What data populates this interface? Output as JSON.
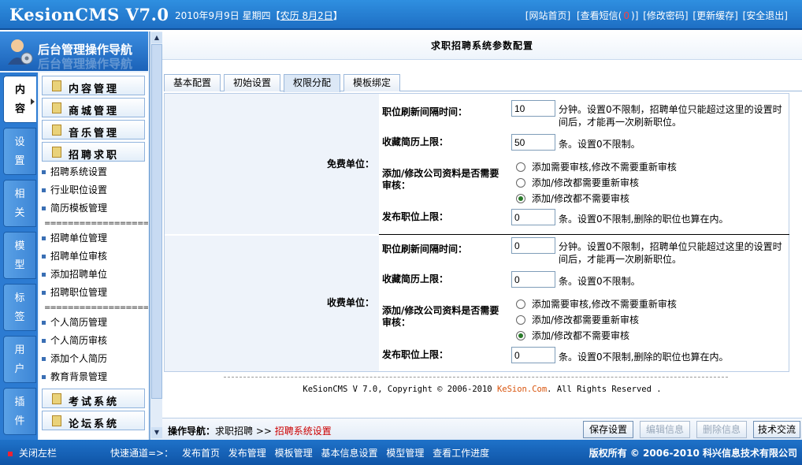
{
  "header": {
    "logo": "KesionCMS V7.0",
    "date_prefix": "2010年9月9日 星期四【",
    "lunar": "农历 8月2日",
    "date_suffix": "】",
    "links": [
      "[网站首页]",
      "[查看短信(",
      "0",
      ")]",
      "[修改密码]",
      "[更新缓存]",
      "[安全退出]"
    ]
  },
  "sidebar": {
    "title": "后台管理操作导航",
    "vertical_tabs": [
      "内\n容",
      "设\n置",
      "相\n关",
      "模\n型",
      "标\n签",
      "用\n户",
      "插\n件"
    ],
    "menu_heads": [
      "内容管理",
      "商城管理",
      "音乐管理",
      "招聘求职"
    ],
    "recruit_items": [
      "招聘系统设置",
      "行业职位设置",
      "简历模板管理"
    ],
    "sep": "==================",
    "company_items": [
      "招聘单位管理",
      "招聘单位审核",
      "添加招聘单位",
      "招聘职位管理"
    ],
    "resume_items": [
      "个人简历管理",
      "个人简历审核",
      "添加个人简历",
      "教育背景管理"
    ],
    "bottom_heads": [
      "考试系统",
      "论坛系统"
    ]
  },
  "main": {
    "title": "求职招聘系统参数配置",
    "tabs": [
      "基本配置",
      "初始设置",
      "权限分配",
      "模板绑定"
    ],
    "free": {
      "unit": "免费单位：",
      "refresh_label": "职位刷新间隔时间：",
      "refresh_value": "10",
      "refresh_note": "分钟。设置0不限制，招聘单位只能超过这里的设置时间后，才能再一次刷新职位。",
      "fav_label": "收藏简历上限：",
      "fav_value": "50",
      "fav_note": "条。设置0不限制。",
      "review_label": "添加/修改公司资料是否需要审核：",
      "review_options": [
        "添加需要审核,修改不需要重新审核",
        "添加/修改都需要重新审核",
        "添加/修改都不需要审核"
      ],
      "post_label": "发布职位上限：",
      "post_value": "0",
      "post_note": "条。设置0不限制,删除的职位也算在内。"
    },
    "paid": {
      "unit": "收费单位：",
      "refresh_label": "职位刷新间隔时间：",
      "refresh_value": "0",
      "refresh_note": "分钟。设置0不限制，招聘单位只能超过这里的设置时间后，才能再一次刷新职位。",
      "fav_label": "收藏简历上限：",
      "fav_value": "0",
      "fav_note": "条。设置0不限制。",
      "review_label": "添加/修改公司资料是否需要审核：",
      "review_options": [
        "添加需要审核,修改不需要重新审核",
        "添加/修改都需要重新审核",
        "添加/修改都不需要审核"
      ],
      "post_label": "发布职位上限：",
      "post_value": "0",
      "post_note": "条。设置0不限制,删除的职位也算在内。"
    },
    "copyright_pre": "KeSionCMS V 7.0, Copyright © 2006-2010 ",
    "copyright_link": "KeSion.Com",
    "copyright_post": ". All Rights Reserved .",
    "opnav_label": "操作导航：",
    "opnav_path": "求职招聘 >> ",
    "opnav_current": "招聘系统设置",
    "buttons": {
      "save": "保存设置",
      "edit": "编辑信息",
      "delete": "删除信息",
      "support": "技术交流"
    }
  },
  "footer": {
    "close": "关闭左栏",
    "quick_label": "快速通道=>：",
    "quick_links": [
      "发布首页",
      "发布管理",
      "模板管理",
      "基本信息设置",
      "模型管理",
      "查看工作进度"
    ],
    "copyright": "版权所有 © 2006-2010 科兴信息技术有限公司"
  }
}
